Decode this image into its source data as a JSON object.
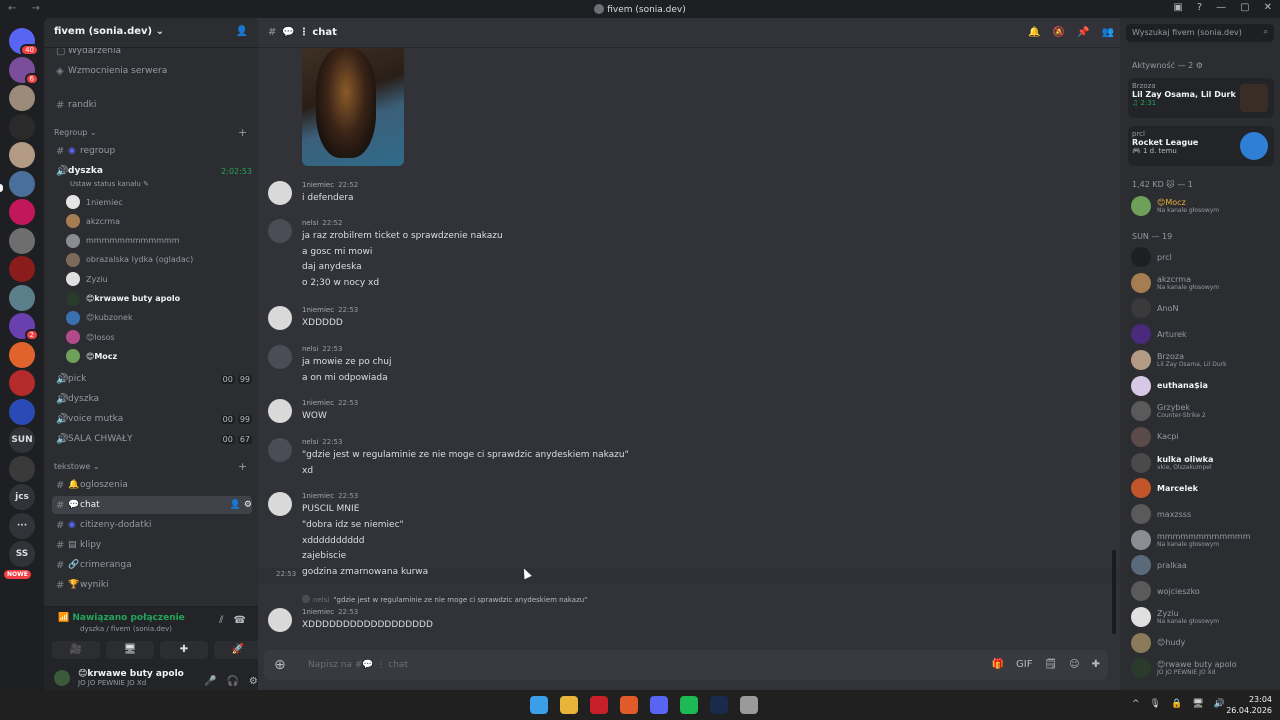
{
  "window": {
    "title": "fivem (sonia.dev)",
    "nav": "← →",
    "controls": [
      "▣",
      "?",
      "—",
      "▢",
      "✕"
    ]
  },
  "servers": {
    "items": [
      {
        "label": "",
        "badge": "40",
        "color": "#5865f2"
      },
      {
        "label": "",
        "badge": "6",
        "color": "#7a4e9a"
      },
      {
        "label": "",
        "badge": "",
        "color": "#9c8a7a"
      },
      {
        "label": "",
        "badge": "",
        "color": "#2a2a2a"
      },
      {
        "label": "",
        "badge": "",
        "color": "#b39a85"
      },
      {
        "label": "",
        "badge": "",
        "color": "#4a6f9c"
      },
      {
        "label": "",
        "badge": "",
        "color": "#c2185b"
      },
      {
        "label": "",
        "badge": "",
        "color": "#6e6e6e"
      },
      {
        "label": "",
        "badge": "",
        "color": "#8b1c1c"
      },
      {
        "label": "",
        "badge": "",
        "color": "#5b7f8a"
      },
      {
        "label": "",
        "badge": "2",
        "color": "#6a3fb0"
      },
      {
        "label": "",
        "badge": "",
        "color": "#e0622d"
      },
      {
        "label": "",
        "badge": "",
        "color": "#b52a2a"
      },
      {
        "label": "",
        "badge": "",
        "color": "#2a4bb5"
      },
      {
        "label": "SUN",
        "badge": "",
        "color": "#1e1f22"
      },
      {
        "label": "",
        "badge": "",
        "color": "#3a3a3a"
      },
      {
        "label": "jcs",
        "badge": "",
        "color": "#313338"
      },
      {
        "label": "···",
        "badge": "",
        "color": "#313338"
      },
      {
        "label": "SS",
        "badge": "",
        "color": "#313338"
      }
    ],
    "new_badge": "NOWE"
  },
  "guild": {
    "name": "fivem (sonia.dev)",
    "chevron": "⌄",
    "member_icon": "👤"
  },
  "channels": {
    "events": "Wydarzenia",
    "boosts": "Wzmocnienia serwera",
    "randki": "randki",
    "category_regroup": "Regroup",
    "regroup": "regroup",
    "dyszka_voice": "dyszka",
    "dyszka_timer": "2:02:53",
    "set_status": "Ustaw status kanału",
    "voice_users": [
      {
        "name": "1niemiec",
        "color": "#e5e5e5",
        "live": false
      },
      {
        "name": "akzcrma",
        "color": "#a67c52",
        "live": false
      },
      {
        "name": "mmmmmmmmmmmm",
        "color": "#8a8d93",
        "live": false
      },
      {
        "name": "obrazalska lydka (ogladac)",
        "color": "#7a6a5a",
        "live": false
      },
      {
        "name": "Zyziu",
        "color": "#e0e0e0",
        "live": false
      },
      {
        "name": "😊krwawe buty apolo",
        "color": "#2b3b2b",
        "live": true
      },
      {
        "name": "😊kubzonek",
        "color": "#3a6fb0",
        "live": false
      },
      {
        "name": "😊losos",
        "color": "#b04a8a",
        "live": false
      },
      {
        "name": "😊Mocz",
        "color": "#6fa05a",
        "live": true
      }
    ],
    "pick": "pick",
    "pick_counts": [
      "00",
      "99"
    ],
    "dyszka_text": "dyszka",
    "voice_mutka": "voice mutka",
    "voice_mutka_counts": [
      "00",
      "99"
    ],
    "sala_chwaly": "SALA CHWAŁY",
    "sala_counts": [
      "00",
      "67"
    ],
    "category_tekstowe": "tekstowe",
    "ogloszenia": "ogloszenia",
    "chat": "chat",
    "citizeny": "citizeny-dodatki",
    "klipy": "klipy",
    "crimeranga": "crimeranga",
    "wyniki": "wyniki"
  },
  "connection": {
    "status": "Nawiązano połączenie",
    "detail": "dyszka / fivem (sonia.dev)",
    "controls": [
      "🎥",
      "🖥",
      "✚",
      "🚀"
    ]
  },
  "user": {
    "name": "😊krwawe buty apolo",
    "status": "JO JO PEWNIE JO Xd",
    "controls": [
      "🎤",
      "🎧",
      "⚙"
    ]
  },
  "chat": {
    "channel": "chat",
    "header_icons": [
      "🔔",
      "🔕",
      "📌",
      "👥"
    ],
    "messages": [
      {
        "author": "1niemiec",
        "time": "22:52",
        "lines": [
          "i defendera"
        ],
        "av": "light"
      },
      {
        "author": "nelsi",
        "time": "22:52",
        "lines": [
          "ja raz zrobilrem ticket o sprawdzenie nakazu",
          "a gosc mi mowi",
          "daj anydeska",
          "o 2;30 w nocy xd"
        ],
        "av": "dark"
      },
      {
        "author": "1niemiec",
        "time": "22:53",
        "lines": [
          "XDDDDD"
        ],
        "av": "light"
      },
      {
        "author": "nelsi",
        "time": "22:53",
        "lines": [
          "ja mowie ze po chuj",
          "a on mi odpowiada"
        ],
        "av": "dark"
      },
      {
        "author": "1niemiec",
        "time": "22:53",
        "lines": [
          "WOW"
        ],
        "av": "light"
      },
      {
        "author": "nelsi",
        "time": "22:53",
        "lines": [
          "\"gdzie jest w regulaminie ze nie moge ci sprawdzic anydeskiem nakazu\"",
          "xd"
        ],
        "av": "dark"
      },
      {
        "author": "1niemiec",
        "time": "22:53",
        "lines": [
          "PUSCIL MNIE",
          "\"dobra idz se niemiec\"",
          "xdddddddddd",
          "zajebiscie",
          "godzina zmarnowana kurwa"
        ],
        "av": "light"
      },
      {
        "author": "1niemiec",
        "time": "22:53",
        "lines": [
          "XDDDDDDDDDDDDDDDDDD"
        ],
        "av": "light"
      }
    ],
    "hover_ts": "22:53",
    "reply_author": "nelsi",
    "reply_text": "\"gdzie jest w regulaminie ze nie moge ci sprawdzic anydeskiem nakazu\"",
    "composer_placeholder": "Napisz na #💬 ⋮ chat",
    "composer_icons": [
      "🎁",
      "GIF",
      "🗒",
      "☺",
      "✚"
    ]
  },
  "members": {
    "search_placeholder": "Wyszukaj fivem (sonia.dev)",
    "activity_header": "Aktywność — 2 ⚙",
    "activities": [
      {
        "who": "Brzoza",
        "title": "Lil Zay Osama, Lil Durk",
        "sub": "♫ 2:31"
      },
      {
        "who": "prcl",
        "title": "Rocket League",
        "sub": "🎮 1 d. temu"
      }
    ],
    "group1_header": "1,42 KD 🐱 — 1",
    "group1": [
      {
        "name": "😊Mocz",
        "sub": "Na kanale głosowym",
        "cls": "gold",
        "color": "#6fa05a"
      }
    ],
    "group2_header": "SUN — 19",
    "group2": [
      {
        "name": "prcl",
        "sub": "",
        "cls": "",
        "color": "#1e1f22"
      },
      {
        "name": "akzcrma",
        "sub": "Na kanale głosowym",
        "cls": "",
        "color": "#a67c52"
      },
      {
        "name": "AnoN",
        "sub": "",
        "cls": "",
        "color": "#3a3a3a"
      },
      {
        "name": "Arturek",
        "sub": "",
        "cls": "",
        "color": "#4a2a7a"
      },
      {
        "name": "Brzoza",
        "sub": "Lil Zay Osama, Lil Durk",
        "cls": "",
        "color": "#b39a85"
      },
      {
        "name": "euthana$ia",
        "sub": "",
        "cls": "on",
        "color": "#d8c8e8"
      },
      {
        "name": "Grzybek",
        "sub": "Counter-Strike 2",
        "cls": "",
        "color": "#5a5a5a"
      },
      {
        "name": "Kacpi",
        "sub": "",
        "cls": "",
        "color": "#5a4a4a"
      },
      {
        "name": "kulka oliwka",
        "sub": "vkie, Olszakumpel",
        "cls": "on",
        "color": "#4a4a4a"
      },
      {
        "name": "Marcelek",
        "sub": "",
        "cls": "on",
        "color": "#c2552a"
      },
      {
        "name": "maxzsss",
        "sub": "",
        "cls": "",
        "color": "#5a5a5a"
      },
      {
        "name": "mmmmmmmmmmmm",
        "sub": "Na kanale głosowym",
        "cls": "",
        "color": "#8a8d93"
      },
      {
        "name": "pralkaa",
        "sub": "",
        "cls": "",
        "color": "#5a6a7a"
      },
      {
        "name": "wojcieszko",
        "sub": "",
        "cls": "",
        "color": "#5a5a5a"
      },
      {
        "name": "Zyziu",
        "sub": "Na kanale głosowym",
        "cls": "",
        "color": "#e0e0e0"
      },
      {
        "name": "😊hudy",
        "sub": "",
        "cls": "",
        "color": "#8a7a5a"
      },
      {
        "name": "😊rwawe buty apolo",
        "sub": "JO JO PEWNIE JO Xd",
        "cls": "",
        "color": "#2b3b2b"
      }
    ]
  },
  "taskbar": {
    "time": "23:04",
    "date": "26.04.2026",
    "tray": [
      "^",
      "🎙",
      "🔒",
      "🖥",
      "🔊"
    ],
    "apps": [
      {
        "name": "windows",
        "color": "#3a9ee8"
      },
      {
        "name": "explorer",
        "color": "#e8b53a"
      },
      {
        "name": "acrobat",
        "color": "#c8202a"
      },
      {
        "name": "brave",
        "color": "#e05a2a"
      },
      {
        "name": "discord",
        "color": "#5865f2"
      },
      {
        "name": "spotify",
        "color": "#1db954"
      },
      {
        "name": "steam",
        "color": "#1a2a4a"
      },
      {
        "name": "chrome",
        "color": "#9a9a9a"
      }
    ]
  }
}
